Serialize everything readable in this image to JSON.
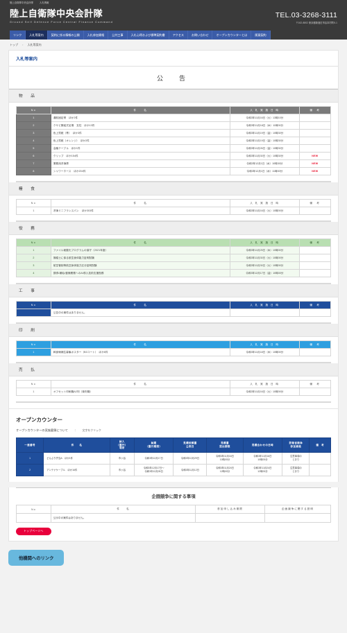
{
  "utility_bar": {
    "org": "陸上自衛隊中央会計隊",
    "page": "入札情報"
  },
  "header": {
    "brand_ja": "陸上自衛隊中央会計隊",
    "brand_en": "Ground  Self  Defence  Force  Central  Finance  Command",
    "tel": "TEL.03-3268-3111",
    "address": "〒162-8802 東京都新宿区市谷本村町5-1"
  },
  "nav": {
    "items": [
      {
        "label": "リンク",
        "active": false
      },
      {
        "label": "入札等案内",
        "active": true
      },
      {
        "label": "契約に係る情報の公開",
        "active": false
      },
      {
        "label": "入札参加資格",
        "active": false
      },
      {
        "label": "公共工事",
        "active": false
      },
      {
        "label": "入札心得および標準契約書",
        "active": false
      },
      {
        "label": "アクセス",
        "active": false
      },
      {
        "label": "お問い合わせ",
        "active": false
      },
      {
        "label": "オープンカウンターとは",
        "active": false
      },
      {
        "label": "随意契約",
        "active": false
      }
    ]
  },
  "breadcrumb": {
    "home": "トップ",
    "current": "入札等案内"
  },
  "page": {
    "title": "入札等案内",
    "announce_heading": "公　告"
  },
  "table_headers": {
    "no": "No",
    "item": "件　　名",
    "date": "入 札 実 施 日 時",
    "note": "備　考"
  },
  "sections": [
    {
      "name": "物　品",
      "theme": "t-grey",
      "rows": [
        {
          "no": "1",
          "item": "運航固定帯　ほか2件",
          "date": "令和3年11月16日（火）13時10分",
          "note": ""
        },
        {
          "no": "2",
          "item": "クサビ緊結式足場　支柱　ほか13件",
          "date": "令和3年11月18日（木）11時00分",
          "note": ""
        },
        {
          "no": "3",
          "item": "色上質紙（青）　ほか3件",
          "date": "令和3年11月19日（金）10時30分",
          "note": ""
        },
        {
          "no": "4",
          "item": "色上質紙（オレンジ）　ほか2件",
          "date": "令和3年11月19日（金）10時30分",
          "note": ""
        },
        {
          "no": "5",
          "item": "会議テーブル　ほか1件",
          "date": "令和3年11月26日（金）10時30分",
          "note": ""
        },
        {
          "no": "6",
          "item": "クリップ　ほか154件",
          "date": "令和3年11月30日（火）10時30分",
          "note": "NEW"
        },
        {
          "no": "7",
          "item": "業務用冷凍庫",
          "date": "令和3年12月1日（水）10時30分",
          "note": "NEW"
        },
        {
          "no": "8",
          "item": "シャワーホース　ほか204件",
          "date": "令和3年12月1日（水）11時00分",
          "note": "NEW"
        }
      ]
    },
    {
      "name": "糧　食",
      "theme": "t-light",
      "rows": [
        {
          "no": "1",
          "item": "冷凍ミニフランスパン　ほか303件",
          "date": "令和3年11月16日（火）10時00分",
          "note": ""
        }
      ]
    },
    {
      "name": "役　務",
      "theme": "t-green",
      "rows": [
        {
          "no": "1",
          "item": "ファイル秘匿化プログラムの保守（2021年度）",
          "date": "令和3年11月25日（木）10時00分",
          "note": ""
        },
        {
          "no": "2",
          "item": "操縦士に係る航空身体能力証明試験",
          "date": "令和3年11月30日（火）10時00分",
          "note": ""
        },
        {
          "no": "3",
          "item": "航空管制等航空身体能力区分証明試験",
          "date": "令和3年11月30日（火）10時00分",
          "note": ""
        },
        {
          "no": "4",
          "item": "誘導・補給・整備業務へのAI導入技術支援役務",
          "date": "令和3年12月17日（金）10時00分",
          "note": ""
        }
      ]
    },
    {
      "name": "工　事",
      "theme": "t-navy",
      "rows": [
        {
          "no": "",
          "item": "公告中の案件はありません。",
          "date": "",
          "note": ""
        }
      ]
    },
    {
      "name": "印　刷",
      "theme": "t-cyan",
      "rows": [
        {
          "no": "1",
          "item": "幹部候補生募集ポスター（B3コート）　ほか6件",
          "date": "令和3年11月18日（木）10時00分",
          "note": ""
        }
      ]
    },
    {
      "name": "売　払",
      "theme": "t-light",
      "rows": [
        {
          "no": "1",
          "item": "オフセット印刷機A2判（菊判機）",
          "date": "令和3年11月16日（火）10時00分",
          "note": ""
        }
      ]
    }
  ],
  "open_counter": {
    "title": "オープンカウンター",
    "subtitle": "オープンカウンターの実施要領について",
    "colon": "：",
    "hint": "文字をクリック",
    "headers": [
      "一連番号",
      "件　　名",
      "納入\n（履行）\n場所",
      "納期\n（履行期限）",
      "見積依頼書\n公表日",
      "見積書\n提出期限",
      "見積合わせの日時",
      "防衛省競争\n参加資格",
      "備　考"
    ],
    "rows": [
      {
        "no": "1",
        "item": "どんぶり弁当A　ほか1件",
        "place": "市ヶ谷",
        "deadline": "令和3年12月17日",
        "publish": "令和3年10月29日",
        "submit": "令和3年11月16日\n10時00分",
        "meeting": "令和3年11月16日\n10時00分",
        "qualification": "注意事項の\nとおり",
        "note": ""
      },
      {
        "no": "2",
        "item": "アンテナケーブル　ほか16件",
        "place": "市ヶ谷",
        "deadline": "令和3年12月17日～\n令和3年12月28日",
        "publish": "令和3年11月12日",
        "submit": "令和3年11月24日\n12時00分",
        "meeting": "令和3年11月24日\n12時00分",
        "qualification": "注意事項の\nとおり",
        "note": ""
      }
    ]
  },
  "planning_competition": {
    "title": "企画競争に関する事項",
    "headers": [
      "No",
      "件　　名",
      "参加申し込み期限",
      "企画競争に関する説明"
    ],
    "rows": [
      {
        "no": "",
        "item": "公示中の案件はありません。",
        "apply": "",
        "desc": ""
      }
    ],
    "top_button": "トップページへ"
  },
  "footer": {
    "links_button": "他機関へのリンク"
  }
}
